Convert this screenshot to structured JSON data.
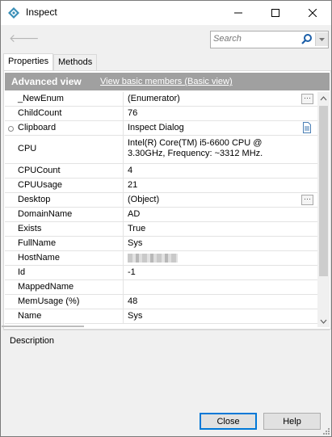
{
  "window": {
    "title": "Inspect",
    "minimize_glyph": "—",
    "maximize_glyph": "☐",
    "close_glyph": "✕"
  },
  "toolbar": {
    "back_icon": "back-arrow-icon",
    "search_placeholder": "Search"
  },
  "tabs": [
    {
      "label": "Properties",
      "active": true
    },
    {
      "label": "Methods",
      "active": false
    }
  ],
  "view": {
    "title": "Advanced view",
    "link": "View basic members (Basic view)"
  },
  "properties": [
    {
      "name": "_NewEnum",
      "value": "(Enumerator)",
      "button": "ellipsis"
    },
    {
      "name": "ChildCount",
      "value": "76"
    },
    {
      "name": "Clipboard",
      "value": "Inspect Dialog",
      "button": "document",
      "marker": true
    },
    {
      "name": "CPU",
      "value": "Intel(R) Core(TM) i5-6600 CPU @ 3.30GHz, Frequency: ~3312 MHz."
    },
    {
      "name": "CPUCount",
      "value": "4"
    },
    {
      "name": "CPUUsage",
      "value": "21"
    },
    {
      "name": "Desktop",
      "value": "(Object)",
      "button": "ellipsis"
    },
    {
      "name": "DomainName",
      "value": "AD"
    },
    {
      "name": "Exists",
      "value": "True"
    },
    {
      "name": "FullName",
      "value": "Sys"
    },
    {
      "name": "HostName",
      "value": ""
    },
    {
      "name": "Id",
      "value": "-1"
    },
    {
      "name": "MappedName",
      "value": ""
    },
    {
      "name": "MemUsage (%)",
      "value": "48"
    },
    {
      "name": "Name",
      "value": "Sys"
    }
  ],
  "description": {
    "title": "Description"
  },
  "buttons": {
    "close_label": "Close",
    "help_label": "Help"
  }
}
